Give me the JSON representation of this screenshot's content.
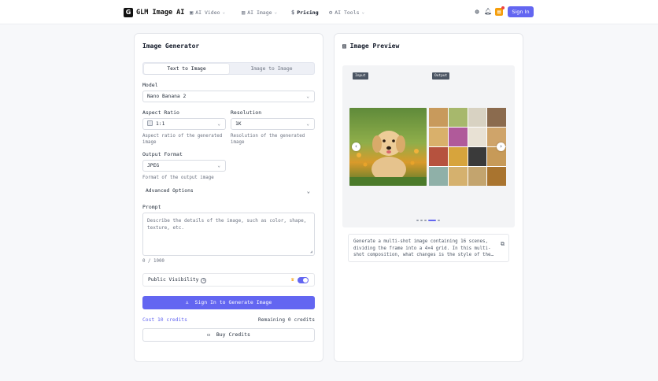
{
  "brand": {
    "logo_letter": "G",
    "name": "GLM Image AI"
  },
  "nav": {
    "ai_video": "AI Video",
    "ai_image": "AI Image",
    "pricing": "Pricing",
    "ai_tools": "AI Tools",
    "sign_in": "Sign In"
  },
  "left": {
    "title": "Image Generator",
    "tabs": [
      "Text to Image",
      "Image to Image"
    ],
    "model_label": "Model",
    "model_value": "Nano Banana 2",
    "aspect_label": "Aspect Ratio",
    "aspect_value": "1:1",
    "aspect_help": "Aspect ratio of the generated image",
    "resolution_label": "Resolution",
    "resolution_value": "1K",
    "resolution_help": "Resolution of the generated image",
    "format_label": "Output Format",
    "format_value": "JPEG",
    "format_help": "Format of the output image",
    "advanced": "Advanced Options",
    "prompt_label": "Prompt",
    "prompt_placeholder": "Describe the details of the image, such as color, shape, texture, etc.",
    "prompt_count": "0 / 1000",
    "visibility_label": "Public Visibility",
    "generate_button": "Sign In to Generate Image",
    "cost": "Cost 10 credits",
    "remaining": "Remaining 0 credits",
    "buy_button": "Buy Credits"
  },
  "right": {
    "title": "Image Preview",
    "input_tag": "Input",
    "output_tag": "Output",
    "description": "Generate a multi-shot image containing 16 scenes, dividing the frame into a 4×4 grid. In this multi-shot composition, what changes is the style of the…"
  },
  "colors": {
    "accent": "#6366f1",
    "cart": "#f59e0b"
  }
}
